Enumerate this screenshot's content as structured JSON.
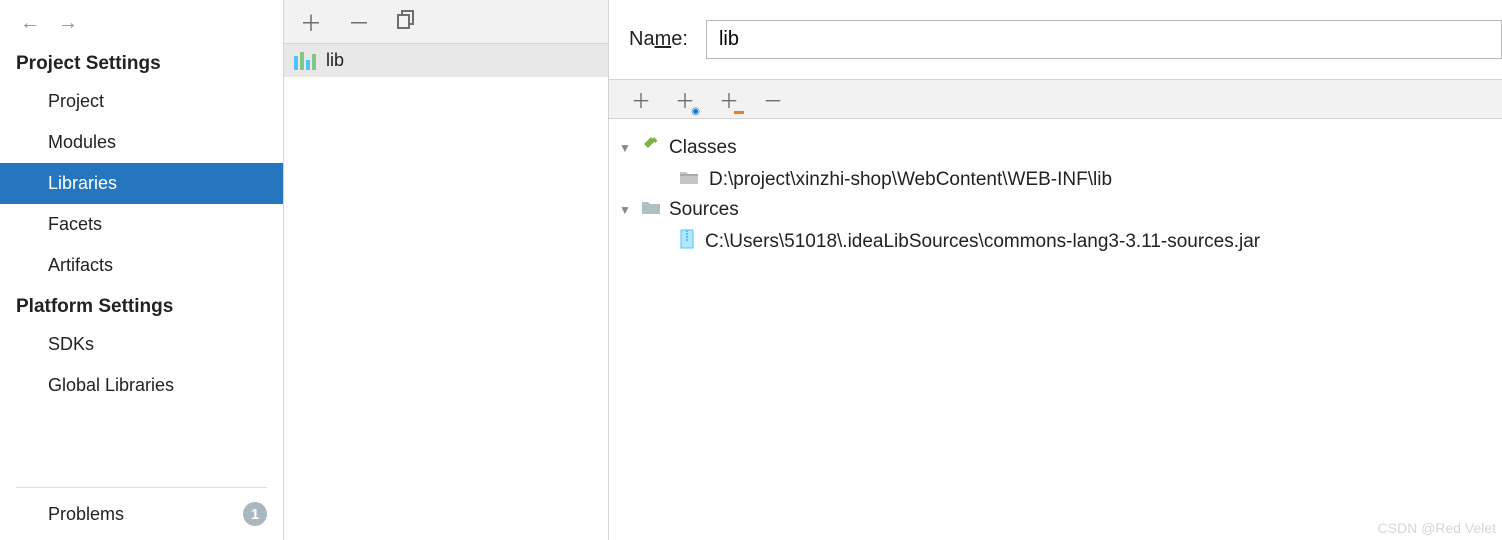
{
  "sidebar": {
    "sections": {
      "project_settings": {
        "heading": "Project Settings",
        "items": [
          "Project",
          "Modules",
          "Libraries",
          "Facets",
          "Artifacts"
        ],
        "selected_index": 2
      },
      "platform_settings": {
        "heading": "Platform Settings",
        "items": [
          "SDKs",
          "Global Libraries"
        ]
      }
    },
    "problems": {
      "label": "Problems",
      "count": "1"
    }
  },
  "middle": {
    "library_name": "lib"
  },
  "main": {
    "name_label_pre": "Na",
    "name_label_u": "m",
    "name_label_post": "e:",
    "name_value": "lib",
    "tree": {
      "classes": {
        "label": "Classes",
        "path": "D:\\project\\xinzhi-shop\\WebContent\\WEB-INF\\lib"
      },
      "sources": {
        "label": "Sources",
        "path": "C:\\Users\\51018\\.ideaLibSources\\commons-lang3-3.11-sources.jar"
      }
    }
  },
  "watermark": "CSDN @Red Velet"
}
